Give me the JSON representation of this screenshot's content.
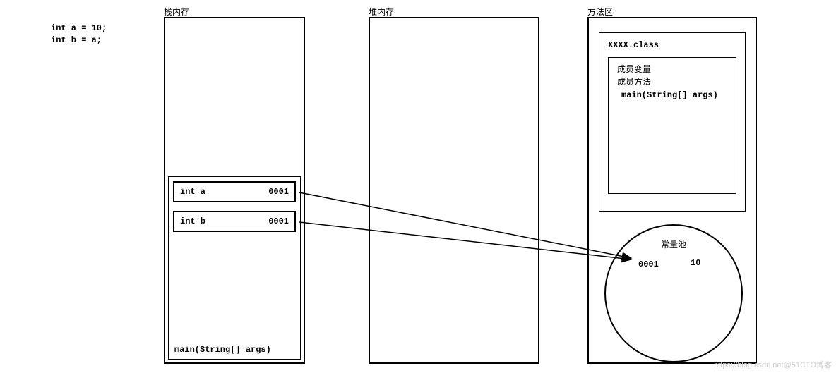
{
  "code": {
    "line1": "int a = 10;",
    "line2": "int b = a;"
  },
  "regions": {
    "stack_label": "栈内存",
    "heap_label": "堆内存",
    "method_label": "方法区"
  },
  "stack": {
    "frame_name": "main(String[] args)",
    "vars": [
      {
        "name": "int a",
        "addr": "0001"
      },
      {
        "name": "int b",
        "addr": "0001"
      }
    ]
  },
  "method_area": {
    "class_name": "XXXX.class",
    "member_var_label": "成员变量",
    "member_method_label": "成员方法",
    "main_sig": "main(String[] args)"
  },
  "constant_pool": {
    "title": "常量池",
    "addr": "0001",
    "value": "10"
  },
  "watermark": "https://blog.csdn.net@51CTO博客"
}
